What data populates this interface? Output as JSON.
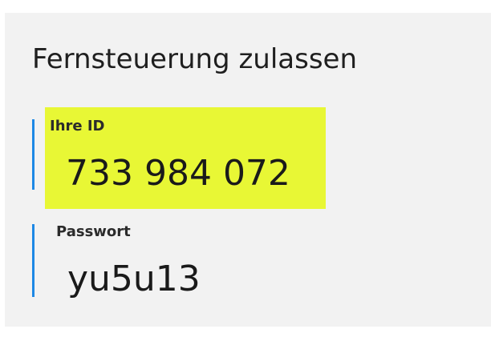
{
  "remote": {
    "title": "Fernsteuerung zulassen",
    "id_label": "Ihre ID",
    "id_value": "733 984 072",
    "password_label": "Passwort",
    "password_value": "yu5u13"
  },
  "colors": {
    "accent_bar": "#1e88e5",
    "highlight": "#e8f735",
    "panel_background": "#f2f2f2"
  }
}
